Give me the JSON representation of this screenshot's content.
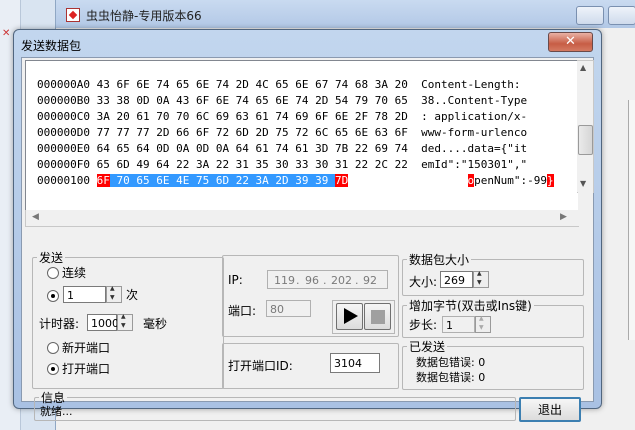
{
  "background": {
    "window_title": "虫虫怡静-专用版本66"
  },
  "dialog": {
    "title": "发送数据包",
    "close_glyph": "✕"
  },
  "hex_lines": [
    {
      "addr": "000000A0",
      "bytes": "43 6F 6E 74 65 6E 74 2D 4C 65 6E 67 74 68 3A 20",
      "ascii": "Content-Length: "
    },
    {
      "addr": "000000B0",
      "bytes": "33 38 0D 0A 43 6F 6E 74 65 6E 74 2D 54 79 70 65",
      "ascii": "38..Content-Type"
    },
    {
      "addr": "000000C0",
      "bytes": "3A 20 61 70 70 6C 69 63 61 74 69 6F 6E 2F 78 2D",
      "ascii": ": application/x-"
    },
    {
      "addr": "000000D0",
      "bytes": "77 77 77 2D 66 6F 72 6D 2D 75 72 6C 65 6E 63 6F",
      "ascii": "www-form-urlenco"
    },
    {
      "addr": "000000E0",
      "bytes": "64 65 64 0D 0A 0D 0A 64 61 74 61 3D 7B 22 69 74",
      "ascii": "ded....data={\"it"
    },
    {
      "addr": "000000F0",
      "bytes": "65 6D 49 64 22 3A 22 31 35 30 33 30 31 22 2C 22",
      "ascii": "emId\":\"150301\",\""
    }
  ],
  "hex_last": {
    "addr": "00000100",
    "b_first": "6F",
    "b_mid": "70 65 6E 4E 75 6D 22 3A 2D 39 39",
    "b_last": "7D",
    "a_first": "o",
    "a_mid": "penNum\":-99",
    "a_last": "}"
  },
  "send": {
    "legend": "发送",
    "continuous_label": "连续",
    "count_value": "1",
    "count_unit": "次",
    "timer_label": "计时器:",
    "timer_value": "1000",
    "timer_unit": "毫秒",
    "new_port_label": "新开端口",
    "open_port_label": "打开端口",
    "count_selected": true,
    "open_port_selected": true
  },
  "conn": {
    "ip_label": "IP:",
    "ip": [
      "119",
      "96",
      "202",
      "92"
    ],
    "port_label": "端口:",
    "port_value": "80",
    "open_port_id_label": "打开端口ID:",
    "open_port_id_value": "3104"
  },
  "packet_size": {
    "legend": "数据包大小",
    "size_label": "大小:",
    "size_value": "269"
  },
  "add_byte": {
    "legend": "增加字节(双击或Ins键)",
    "step_label": "步长:",
    "step_value": "1"
  },
  "sent": {
    "legend": "已发送",
    "error1": "数据包错误: 0",
    "error2": "数据包错误: 0"
  },
  "info": {
    "legend": "信息",
    "status": "就绪..."
  },
  "exit_label": "退出",
  "colors": {
    "selection": "#3399ff",
    "mismatch": "#ff0000",
    "frame": "#b2c8e6"
  }
}
